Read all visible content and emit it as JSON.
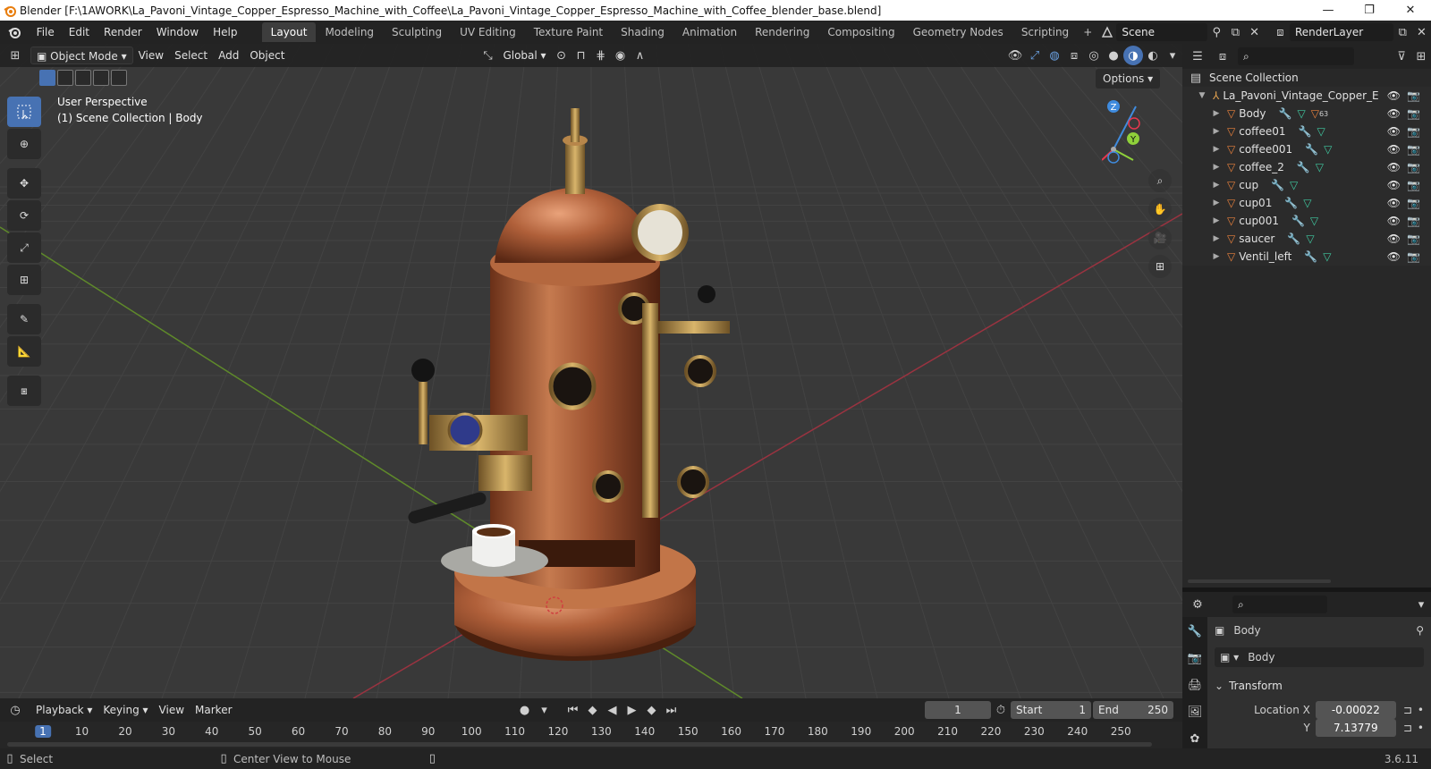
{
  "window": {
    "title": "Blender [F:\\1AWORK\\La_Pavoni_Vintage_Copper_Espresso_Machine_with_Coffee\\La_Pavoni_Vintage_Copper_Espresso_Machine_with_Coffee_blender_base.blend]",
    "minimize": "—",
    "maximize": "❐",
    "close": "✕"
  },
  "menu": [
    "File",
    "Edit",
    "Render",
    "Window",
    "Help"
  ],
  "workspaces": [
    {
      "label": "Layout",
      "active": true
    },
    {
      "label": "Modeling"
    },
    {
      "label": "Sculpting"
    },
    {
      "label": "UV Editing"
    },
    {
      "label": "Texture Paint"
    },
    {
      "label": "Shading"
    },
    {
      "label": "Animation"
    },
    {
      "label": "Rendering"
    },
    {
      "label": "Compositing"
    },
    {
      "label": "Geometry Nodes"
    },
    {
      "label": "Scripting"
    }
  ],
  "workspace_add": "+",
  "scene": {
    "name": "Scene",
    "render_layer": "RenderLayer"
  },
  "viewport_header": {
    "mode": "Object Mode",
    "menus": [
      "View",
      "Select",
      "Add",
      "Object"
    ],
    "transform_orientation": "Global"
  },
  "viewport": {
    "perspective": "User Perspective",
    "collection_info": "(1) Scene Collection | Body",
    "options_label": "Options",
    "gizmo": {
      "x_label": "X",
      "y_label": "Y",
      "z_label": "Z"
    }
  },
  "outliner": {
    "root": "Scene Collection",
    "collection": "La_Pavoni_Vintage_Copper_E",
    "items": [
      {
        "name": "Body",
        "badge": "63"
      },
      {
        "name": "coffee01"
      },
      {
        "name": "coffee001"
      },
      {
        "name": "coffee_2"
      },
      {
        "name": "cup"
      },
      {
        "name": "cup01"
      },
      {
        "name": "cup001"
      },
      {
        "name": "saucer"
      },
      {
        "name": "Ventil_left"
      }
    ]
  },
  "properties": {
    "object_name": "Body",
    "data_name": "Body",
    "panel": "Transform",
    "location_x_label": "Location X",
    "location_x": "-0.00022",
    "location_y_label": "Y",
    "location_y": "7.13779"
  },
  "timeline": {
    "menus": [
      "Playback",
      "Keying",
      "View",
      "Marker"
    ],
    "current_frame": "1",
    "start_label": "Start",
    "start": "1",
    "end_label": "End",
    "end": "250",
    "ruler": [
      "1",
      "10",
      "20",
      "30",
      "40",
      "50",
      "60",
      "70",
      "80",
      "90",
      "100",
      "110",
      "120",
      "130",
      "140",
      "150",
      "160",
      "170",
      "180",
      "190",
      "200",
      "210",
      "220",
      "230",
      "240",
      "250"
    ]
  },
  "status": {
    "select": "Select",
    "center_view": "Center View to Mouse",
    "version": "3.6.11"
  },
  "colors": {
    "accent": "#4772b3",
    "axis_x": "#e8374f",
    "axis_y": "#8fd13a",
    "axis_z": "#3f8bde",
    "copper": "#b8663c"
  }
}
